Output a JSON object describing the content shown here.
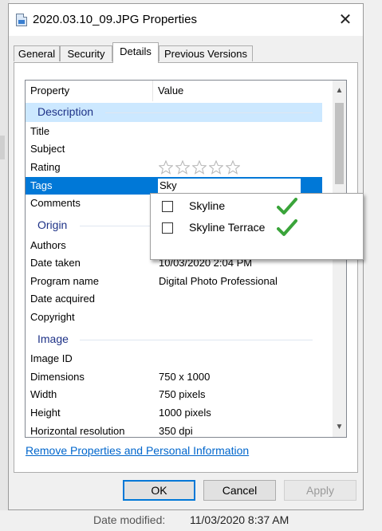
{
  "window": {
    "title": "2020.03.10_09.JPG Properties",
    "close_glyph": "✕",
    "icon": "image-file-icon"
  },
  "tabs": [
    {
      "label": "General",
      "active": false
    },
    {
      "label": "Security",
      "active": false
    },
    {
      "label": "Details",
      "active": true
    },
    {
      "label": "Previous Versions",
      "active": false
    }
  ],
  "list": {
    "header": {
      "property": "Property",
      "value": "Value"
    },
    "groups": {
      "description": "Description",
      "origin": "Origin",
      "image": "Image"
    },
    "rows": {
      "title": {
        "k": "Title",
        "v": ""
      },
      "subject": {
        "k": "Subject",
        "v": ""
      },
      "rating": {
        "k": "Rating",
        "stars": 0,
        "max": 5
      },
      "tags": {
        "k": "Tags",
        "v": "Sky"
      },
      "comments": {
        "k": "Comments",
        "v": ""
      },
      "authors": {
        "k": "Authors",
        "v": ""
      },
      "date_taken": {
        "k": "Date taken",
        "v": "10/03/2020 2:04 PM"
      },
      "program_name": {
        "k": "Program name",
        "v": "Digital Photo Professional"
      },
      "date_acquired": {
        "k": "Date acquired",
        "v": ""
      },
      "copyright": {
        "k": "Copyright",
        "v": ""
      },
      "image_id": {
        "k": "Image ID",
        "v": ""
      },
      "dimensions": {
        "k": "Dimensions",
        "v": "750 x 1000"
      },
      "width": {
        "k": "Width",
        "v": "750 pixels"
      },
      "height": {
        "k": "Height",
        "v": "1000 pixels"
      },
      "horizontal_resolution": {
        "k": "Horizontal resolution",
        "v": "350 dpi"
      }
    }
  },
  "tag_suggestions": [
    {
      "label": "Skyline",
      "checked": false
    },
    {
      "label": "Skyline Terrace",
      "checked": false
    }
  ],
  "link": {
    "remove": "Remove Properties and Personal Information"
  },
  "buttons": {
    "ok": "OK",
    "cancel": "Cancel",
    "apply": "Apply"
  },
  "footer": {
    "label": "Date modified:",
    "value": "11/03/2020 8:37 AM"
  },
  "colors": {
    "selection": "#0078d7",
    "group_text": "#1e3287",
    "group_bg": "#cce8ff",
    "link": "#0066cc",
    "check": "#3aa43a"
  }
}
